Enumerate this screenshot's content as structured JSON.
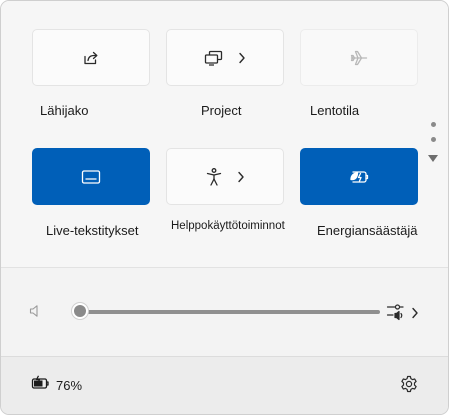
{
  "quick_settings": {
    "tiles": [
      {
        "id": "nearby_sharing",
        "label": "Lähijako",
        "state": "off",
        "icon": "share-icon",
        "has_chevron": false
      },
      {
        "id": "project",
        "label": "Project",
        "state": "off",
        "icon": "project-icon",
        "has_chevron": true
      },
      {
        "id": "airplane_mode",
        "label": "Lentotila",
        "state": "disabled",
        "icon": "airplane-icon",
        "has_chevron": false
      },
      {
        "id": "live_captions",
        "label": "Live-tekstitykset",
        "state": "on",
        "icon": "captions-icon",
        "has_chevron": false
      },
      {
        "id": "accessibility",
        "label": "Helppokäyttötoiminnot",
        "state": "off",
        "icon": "accessibility-icon",
        "has_chevron": true
      },
      {
        "id": "energy_saver",
        "label": "Energiansäästäjä",
        "state": "on",
        "icon": "energy-saver-icon",
        "has_chevron": false
      }
    ],
    "accent_color": "#005fb8"
  },
  "volume": {
    "level_percent": 0,
    "mute_icon": "speaker-icon",
    "output_icon": "audio-output-icon"
  },
  "footer": {
    "battery_percent": "76%",
    "battery_icon": "battery-charging-icon",
    "settings_icon": "gear-icon"
  }
}
